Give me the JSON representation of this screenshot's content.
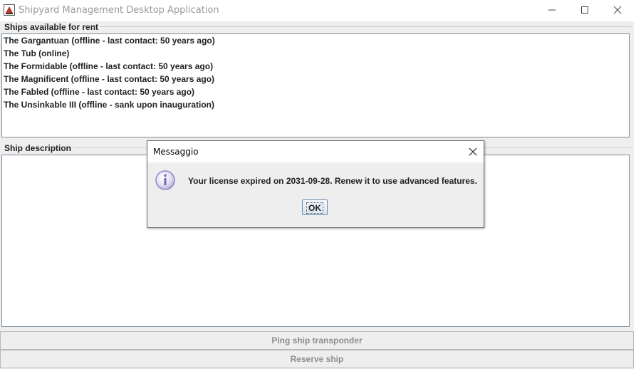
{
  "window": {
    "title": "Shipyard Management Desktop Application",
    "icon": "java-app-icon",
    "controls": [
      "minimize-icon",
      "maximize-icon",
      "close-icon"
    ]
  },
  "ships_section": {
    "title": "Ships available for rent",
    "items": [
      "The Gargantuan (offline - last contact: 50 years ago)",
      "The Tub (online)",
      "The Formidable (offline - last contact: 50 years ago)",
      "The Magnificent (offline - last contact: 50 years ago)",
      "The Fabled (offline - last contact: 50 years ago)",
      "The Unsinkable III (offline - sank upon inauguration)"
    ]
  },
  "description_section": {
    "title": "Ship description",
    "text": ""
  },
  "buttons": {
    "ping": "Ping ship transponder",
    "reserve": "Reserve ship"
  },
  "dialog": {
    "title": "Messaggio",
    "icon": "info-icon",
    "message": "Your license expired on 2031-09-28. Renew it to use advanced features.",
    "ok_label": "OK"
  },
  "colors": {
    "background": "#eeeeee",
    "disabled_text": "#8d8d8d",
    "info_icon": "#8c86c6"
  }
}
